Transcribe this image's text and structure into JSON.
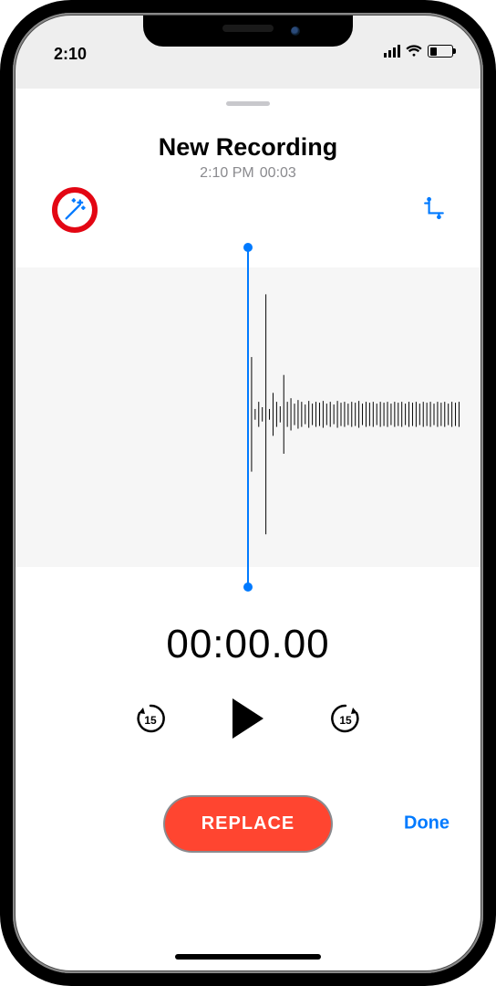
{
  "status": {
    "time": "2:10"
  },
  "header": {
    "title": "New Recording",
    "timestamp": "2:10 PM",
    "duration": "00:03"
  },
  "icons": {
    "enhance": "magic-wand-icon",
    "trim": "trim-icon"
  },
  "playback": {
    "timecode": "00:00.00",
    "skip_seconds": "15"
  },
  "actions": {
    "replace": "REPLACE",
    "done": "Done"
  },
  "colors": {
    "accent": "#007aff",
    "destructive": "#ff4530",
    "highlight_ring": "#e30613"
  }
}
